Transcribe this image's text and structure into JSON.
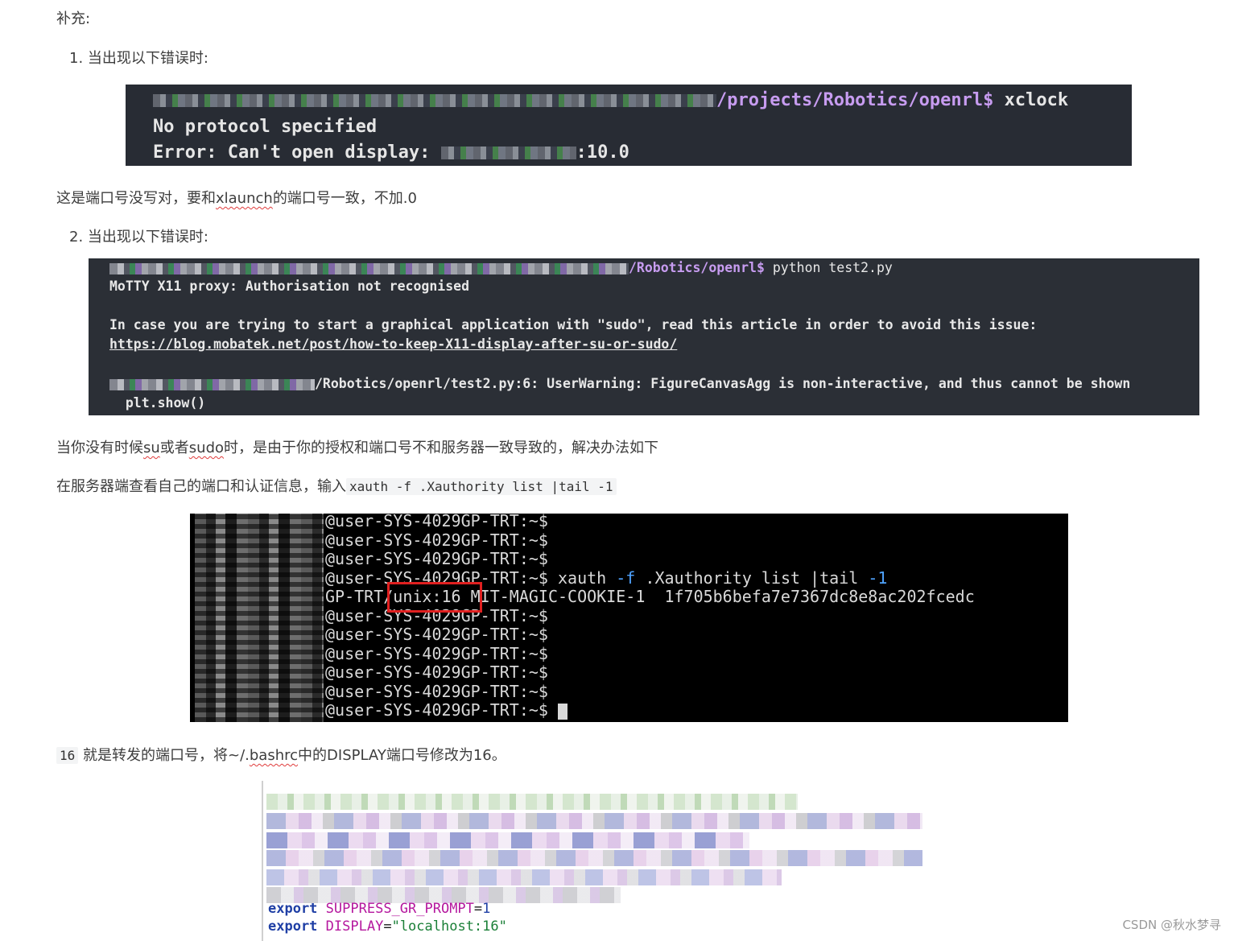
{
  "article": {
    "supplement_heading": "补充:",
    "item1_label": "1. 当出现以下错误时:",
    "terminal1": {
      "line1_path": "/projects/Robotics/openrl$",
      "line1_cmd": "xclock",
      "line2": "No protocol specified",
      "line3_prefix": "Error: Can't open display:",
      "line3_suffix": ":10.0"
    },
    "para1_before": "这是端口号没写对，要和",
    "para1_word": "xlaunch",
    "para1_after": "的端口号一致，不加.0",
    "item2_label": "2. 当出现以下错误时:",
    "terminal2": {
      "line1_path": "/Robotics/openrl$",
      "line1_cmd": "python test2.py",
      "line2": "MoTTY X11 proxy: Authorisation not recognised",
      "line4": "In case you are trying to start a graphical application with \"sudo\", read this article in order to avoid this issue:",
      "line5_link": "https://blog.mobatek.net/post/how-to-keep-X11-display-after-su-or-sudo/",
      "line7": "/Robotics/openrl/test2.py:6: UserWarning: FigureCanvasAgg is non-interactive, and thus cannot be shown",
      "line8": "  plt.show()"
    },
    "para2_a": "当你没有时候",
    "para2_su": "su",
    "para2_b": "或者",
    "para2_sudo": "sudo",
    "para2_c": "时，是由于你的授权和端口号不和服务器一致导致的，解决办法如下",
    "para3_text": "在服务器端查看自己的端口和认证信息，输入",
    "para3_code": "xauth -f .Xauthority list |tail -1",
    "terminal3": {
      "prompt": "@user-SYS-4029GP-TRT:~$",
      "cmd_xauth": "xauth",
      "cmd_flag": "-f",
      "cmd_rest": ".Xauthority list |tail",
      "cmd_num": "-1",
      "result_prefix": "GP-TRT",
      "result_display": "/unix:16",
      "result_rest": " MIT-MAGIC-COOKIE-1  1f705b6befa7e7367dc8e8ac202fcedc"
    },
    "para4_code": "16",
    "para4_a": "就是转发的端口号，将~/.",
    "para4_word": "bashrc",
    "para4_b": "中的DISPLAY端口号修改为16。",
    "bashrc": {
      "kw": "export",
      "var1": "SUPPRESS_GR_PROMPT",
      "eq1": "=",
      "val1": "1",
      "var2": "DISPLAY",
      "eq2": "=",
      "val2": "\"localhost:16\""
    }
  },
  "watermark": "CSDN @秋水梦寻"
}
